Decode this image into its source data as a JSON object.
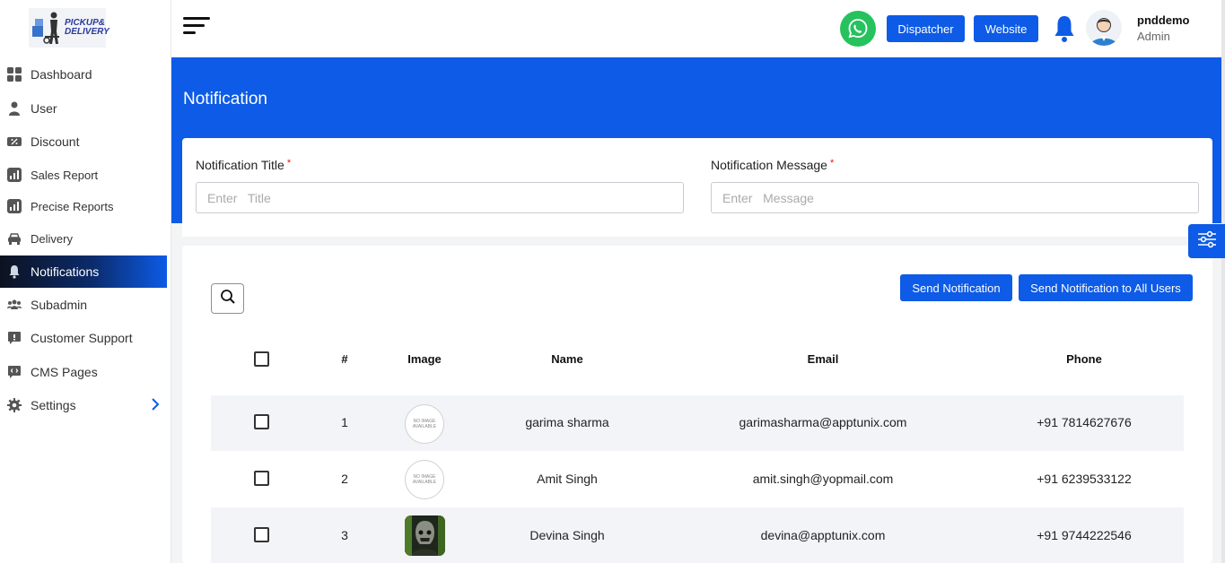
{
  "brand": {
    "logo_line1": "PICKUP&",
    "logo_line2": "DELIVERY"
  },
  "sidebar": {
    "items": [
      {
        "label": "Dashboard",
        "icon": "dashboard-icon"
      },
      {
        "label": "User",
        "icon": "user-icon"
      },
      {
        "label": "Discount",
        "icon": "discount-icon"
      },
      {
        "label": "Sales Report",
        "icon": "report-icon"
      },
      {
        "label": "Precise Reports",
        "icon": "report-icon"
      },
      {
        "label": "Delivery",
        "icon": "car-icon"
      },
      {
        "label": "Notifications",
        "icon": "bell-icon",
        "active": true
      },
      {
        "label": "Subadmin",
        "icon": "users-icon"
      },
      {
        "label": "Customer Support",
        "icon": "chat-icon"
      },
      {
        "label": "CMS Pages",
        "icon": "code-chat-icon"
      },
      {
        "label": "Settings",
        "icon": "gear-icon"
      }
    ]
  },
  "header": {
    "dispatcher_label": "Dispatcher",
    "website_label": "Website",
    "user_name": "pnddemo",
    "user_role": "Admin"
  },
  "page": {
    "title": "Notification",
    "title_label": "Notification Title",
    "title_placeholder": "Enter   Title",
    "message_label": "Notification Message",
    "message_placeholder": "Enter   Message",
    "required_mark": "*",
    "send_label": "Send Notification",
    "send_all_label": "Send Notification to All Users"
  },
  "table": {
    "headers": {
      "num": "#",
      "image": "Image",
      "name": "Name",
      "email": "Email",
      "phone": "Phone"
    },
    "no_image_text": "NO IMAGE AVAILABLE",
    "rows": [
      {
        "num": "1",
        "name": "garima sharma",
        "email": "garimasharma@apptunix.com",
        "phone": "+91 7814627676",
        "image": "no-image"
      },
      {
        "num": "2",
        "name": "Amit Singh",
        "email": "amit.singh@yopmail.com",
        "phone": "+91 6239533122",
        "image": "no-image"
      },
      {
        "num": "3",
        "name": "Devina Singh",
        "email": "devina@apptunix.com",
        "phone": "+91 9744222546",
        "image": "photo"
      }
    ]
  },
  "colors": {
    "accent": "#0d5be6",
    "whatsapp": "#25c25e"
  }
}
